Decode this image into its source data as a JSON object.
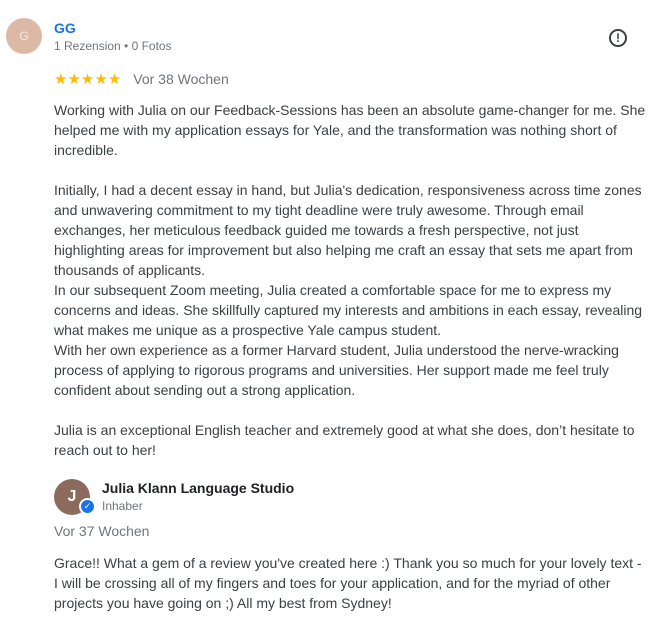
{
  "review": {
    "avatar_initial": "G",
    "reviewer_name": "GG",
    "reviewer_meta": "1 Rezension • 0 Fotos",
    "report_icon": "report-flag-icon",
    "rating": 5,
    "stars": [
      "★",
      "★",
      "★",
      "★",
      "★"
    ],
    "age": "Vor 38 Wochen",
    "paragraphs": [
      "Working with Julia on our Feedback-Sessions has been an absolute game-changer for me. She helped me with my application essays for Yale, and the transformation was nothing short of incredible.",
      "",
      "Initially, I had a decent essay in hand, but Julia's dedication, responsiveness across time zones and unwavering commitment to my tight deadline were truly awesome. Through email exchanges, her meticulous feedback guided me towards a fresh perspective, not just highlighting areas for improvement but also helping me craft an essay that sets me apart from thousands of applicants.",
      "In our subsequent Zoom meeting, Julia created a comfortable space for me to express my concerns and ideas. She skillfully captured my interests and ambitions in each essay, revealing what makes me unique as a prospective Yale campus student.",
      "With her own experience as a former Harvard student, Julia understood the nerve-wracking process of applying to rigorous programs and universities. Her support made me feel truly confident about sending out a strong application.",
      "",
      "Julia is an exceptional English teacher and extremely good at what she does, don’t hesitate to reach out to her!"
    ]
  },
  "owner_response": {
    "avatar_initial": "J",
    "name": "Julia Klann Language Studio",
    "role": "Inhaber",
    "age": "Vor 37 Wochen",
    "text": "Grace!! What a gem of a review you've created here :) Thank you so much for your lovely text - I will be crossing all of my fingers and toes for your application, and for the myriad of other projects you have going on ;) All my best from Sydney!"
  },
  "colors": {
    "star": "#fbbc04",
    "reviewer_name": "#1a73e8",
    "verified_badge": "#1a73e8"
  }
}
